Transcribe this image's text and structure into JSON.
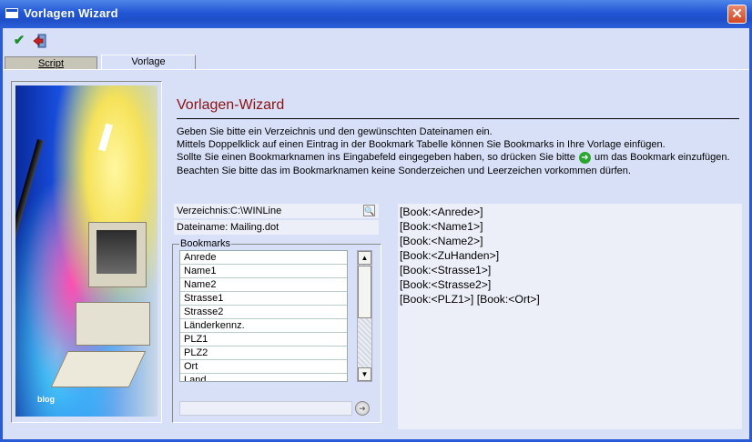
{
  "window": {
    "title": "Vorlagen Wizard",
    "close_label": "✕"
  },
  "toolbar": {
    "ok_icon": "✔",
    "exit_icon": "exit-icon"
  },
  "tabs": [
    {
      "label": "Script"
    },
    {
      "label": "Vorlage"
    }
  ],
  "left_image": {
    "caption": "blog"
  },
  "header": {
    "title": "Vorlagen-Wizard"
  },
  "description": {
    "line1": "Geben Sie bitte ein Verzeichnis und den gewünschten Dateinamen ein.",
    "line2": "Mittels Doppelklick auf einen Eintrag in der Bookmark Tabelle können Sie Bookmarks in Ihre Vorlage einfügen.",
    "line3a": "Sollte Sie einen Bookmarknamen ins Eingabefeld eingegeben haben, so drücken Sie bitte",
    "line3b": "um das Bookmark einzufügen.",
    "line4": "Beachten Sie bitte das im Bookmarknamen keine Sonderzeichen und Leerzeichen vorkommen dürfen."
  },
  "fields": {
    "directory": {
      "label": "Verzeichnis:",
      "value": "C:\\WINLine"
    },
    "filename": {
      "label": "Dateiname:",
      "value": "Mailing.dot"
    }
  },
  "bookmarks": {
    "legend": "Bookmarks",
    "items": [
      "Anrede",
      "Name1",
      "Name2",
      "Strasse1",
      "Strasse2",
      "Länderkennz.",
      "PLZ1",
      "PLZ2",
      "Ort",
      "Land"
    ],
    "input_value": ""
  },
  "preview": {
    "lines": [
      "[Book:<Anrede>]",
      "[Book:<Name1>]",
      "[Book:<Name2>]",
      "[Book:<ZuHanden>]",
      "[Book:<Strasse1>]",
      "[Book:<Strasse2>]",
      "[Book:<PLZ1>] [Book:<Ort>]"
    ]
  }
}
